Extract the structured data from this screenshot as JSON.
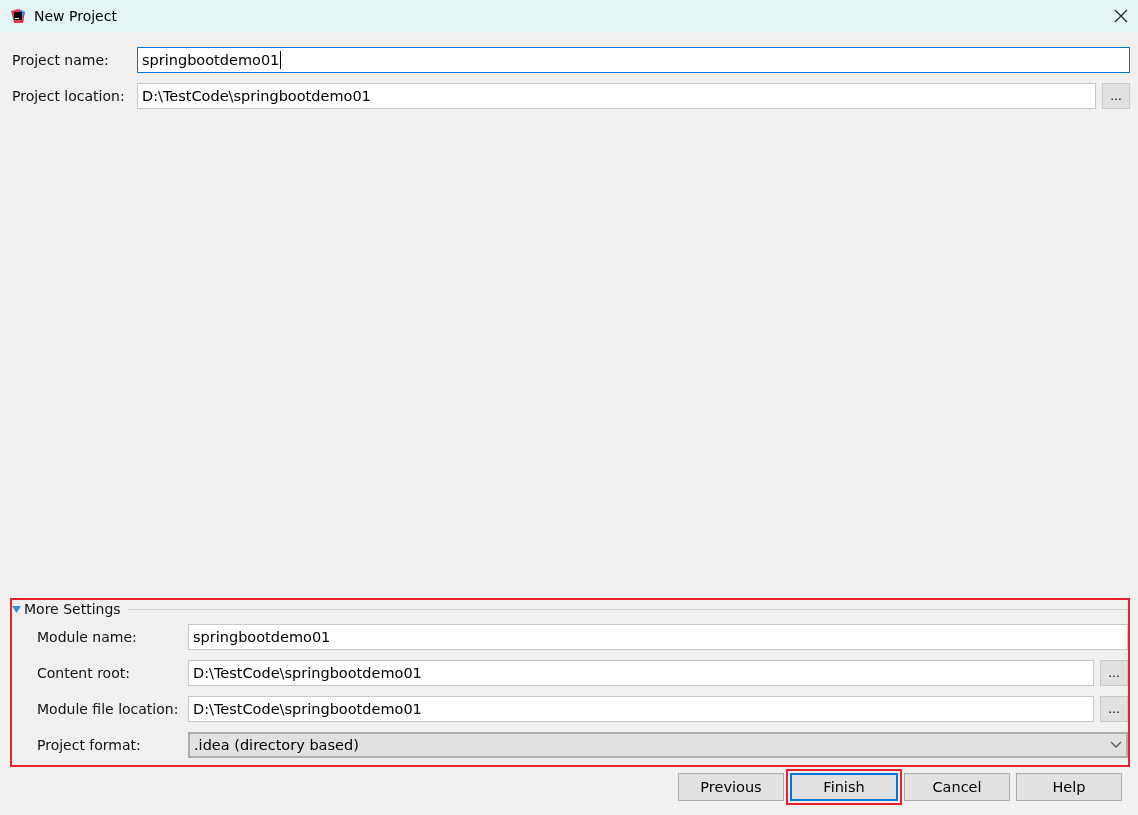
{
  "window": {
    "title": "New Project"
  },
  "project_fields": [
    {
      "label": "Project name:",
      "value": "springbootdemo01",
      "focused": true
    },
    {
      "label": "Project location:",
      "value": "D:\\TestCode\\springbootdemo01",
      "focused": false,
      "browse": "..."
    }
  ],
  "more_settings": {
    "title": "More Settings",
    "expanded": true,
    "highlighted": true,
    "fields": [
      {
        "kind": "text",
        "label": "Module name:",
        "value": "springbootdemo01"
      },
      {
        "kind": "text",
        "label": "Content root:",
        "value": "D:\\TestCode\\springbootdemo01",
        "browse": "..."
      },
      {
        "kind": "text",
        "label": "Module file location:",
        "value": "D:\\TestCode\\springbootdemo01",
        "browse": "..."
      },
      {
        "kind": "select",
        "label": "Project format:",
        "value": ".idea (directory based)"
      }
    ]
  },
  "buttons": [
    {
      "label": "Previous",
      "default": false,
      "highlighted": false
    },
    {
      "label": "Finish",
      "default": true,
      "highlighted": true
    },
    {
      "label": "Cancel",
      "default": false,
      "highlighted": false
    },
    {
      "label": "Help",
      "default": false,
      "highlighted": false
    }
  ]
}
